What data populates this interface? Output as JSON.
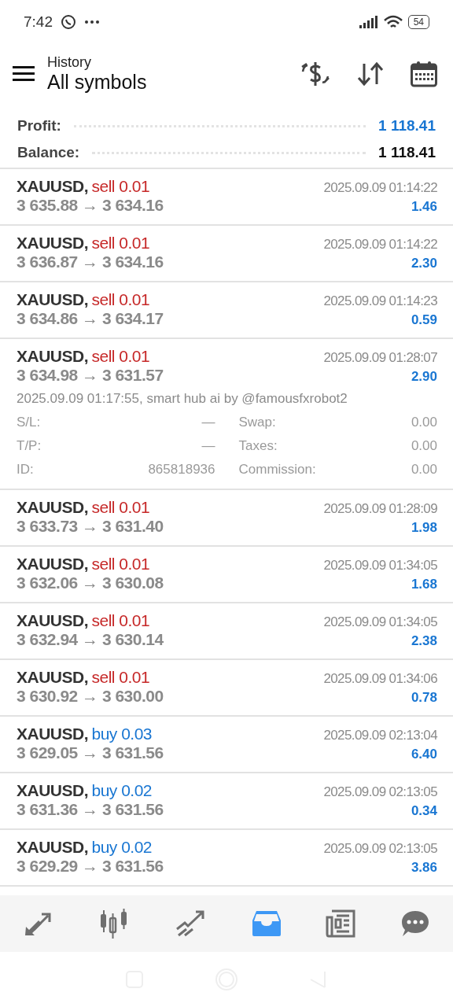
{
  "status_bar": {
    "time": "7:42",
    "battery": "54"
  },
  "header": {
    "subtitle": "History",
    "title": "All symbols"
  },
  "summary": [
    {
      "label": "Profit:",
      "value": "1 118.41",
      "kind": "profit"
    },
    {
      "label": "Balance:",
      "value": "1 118.41",
      "kind": "balance"
    }
  ],
  "deals": [
    {
      "symbol": "XAUUSD,",
      "side": "sell",
      "volume": "0.01",
      "prices": "3 635.88 → 3 634.16",
      "time": "2025.09.09 01:14:22",
      "profit": "1.46",
      "expanded": false
    },
    {
      "symbol": "XAUUSD,",
      "side": "sell",
      "volume": "0.01",
      "prices": "3 636.87 → 3 634.16",
      "time": "2025.09.09 01:14:22",
      "profit": "2.30",
      "expanded": false
    },
    {
      "symbol": "XAUUSD,",
      "side": "sell",
      "volume": "0.01",
      "prices": "3 634.86 → 3 634.17",
      "time": "2025.09.09 01:14:23",
      "profit": "0.59",
      "expanded": false
    },
    {
      "symbol": "XAUUSD,",
      "side": "sell",
      "volume": "0.01",
      "prices": "3 634.98 → 3 631.57",
      "time": "2025.09.09 01:28:07",
      "profit": "2.90",
      "expanded": true,
      "details": {
        "comment": "2025.09.09 01:17:55, smart hub ai by @famousfxrobot2",
        "fields": [
          {
            "label": "S/L:",
            "value": "—"
          },
          {
            "label": "Swap:",
            "value": "0.00"
          },
          {
            "label": "T/P:",
            "value": "—"
          },
          {
            "label": "Taxes:",
            "value": "0.00"
          },
          {
            "label": "ID:",
            "value": "865818936"
          },
          {
            "label": "Commission:",
            "value": "0.00"
          }
        ]
      }
    },
    {
      "symbol": "XAUUSD,",
      "side": "sell",
      "volume": "0.01",
      "prices": "3 633.73 → 3 631.40",
      "time": "2025.09.09 01:28:09",
      "profit": "1.98",
      "expanded": false
    },
    {
      "symbol": "XAUUSD,",
      "side": "sell",
      "volume": "0.01",
      "prices": "3 632.06 → 3 630.08",
      "time": "2025.09.09 01:34:05",
      "profit": "1.68",
      "expanded": false
    },
    {
      "symbol": "XAUUSD,",
      "side": "sell",
      "volume": "0.01",
      "prices": "3 632.94 → 3 630.14",
      "time": "2025.09.09 01:34:05",
      "profit": "2.38",
      "expanded": false
    },
    {
      "symbol": "XAUUSD,",
      "side": "sell",
      "volume": "0.01",
      "prices": "3 630.92 → 3 630.00",
      "time": "2025.09.09 01:34:06",
      "profit": "0.78",
      "expanded": false
    },
    {
      "symbol": "XAUUSD,",
      "side": "buy",
      "volume": "0.03",
      "prices": "3 629.05 → 3 631.56",
      "time": "2025.09.09 02:13:04",
      "profit": "6.40",
      "expanded": false
    },
    {
      "symbol": "XAUUSD,",
      "side": "buy",
      "volume": "0.02",
      "prices": "3 631.36 → 3 631.56",
      "time": "2025.09.09 02:13:05",
      "profit": "0.34",
      "expanded": false
    },
    {
      "symbol": "XAUUSD,",
      "side": "buy",
      "volume": "0.02",
      "prices": "3 629.29 → 3 631.56",
      "time": "2025.09.09 02:13:05",
      "profit": "3.86",
      "expanded": false
    }
  ],
  "bottom_nav": [
    {
      "kind": "quotes",
      "selected": false
    },
    {
      "kind": "chart",
      "selected": false
    },
    {
      "kind": "trade",
      "selected": false
    },
    {
      "kind": "history",
      "selected": true
    },
    {
      "kind": "news",
      "selected": false
    },
    {
      "kind": "chat",
      "selected": false
    }
  ]
}
